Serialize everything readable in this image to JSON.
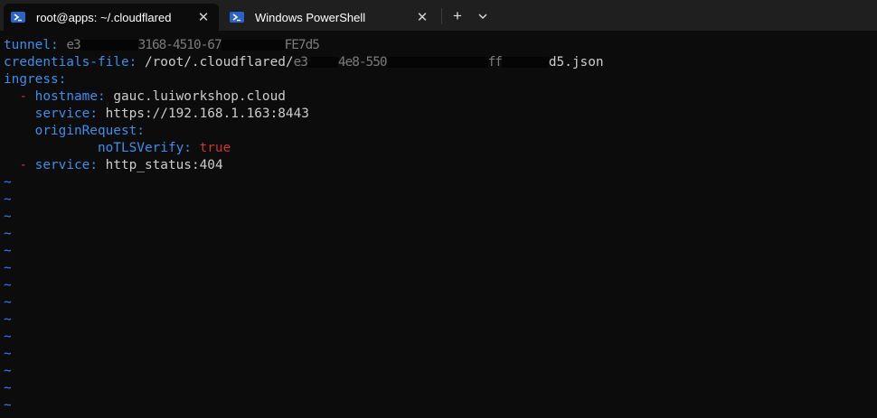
{
  "tabs": [
    {
      "title": "root@apps: ~/.cloudflared",
      "icon": "powershell-icon",
      "active": true
    },
    {
      "title": "Windows PowerShell",
      "icon": "powershell-icon",
      "active": false
    }
  ],
  "tabbar": {
    "new_tab": "+",
    "dropdown": "⌄",
    "close": "✕"
  },
  "editor": {
    "tunnel_key": "tunnel",
    "tunnel_fragments": [
      "e3",
      "3168-4510-67",
      "FE7d5"
    ],
    "credentials_key": "credentials-file",
    "credentials_prefix": "/root/.cloudflared/",
    "credentials_fragments": [
      "e3",
      "4e8-550",
      "ff",
      "d5.json"
    ],
    "ingress_key": "ingress",
    "dash": "-",
    "hostname_key": "hostname",
    "hostname_value": "gauc.luiworkshop.cloud",
    "service_key": "service",
    "service_value": "https://192.168.1.163:8443",
    "origin_key": "originRequest",
    "notls_key": "noTLSVerify",
    "notls_value": "true",
    "service2_value": "http_status:404",
    "tilde": "~"
  },
  "colors": {
    "background": "#0c0c0c",
    "key": "#3b8eea",
    "value": "#cccccc",
    "bool": "#cd3131",
    "tilde": "#3b78ff"
  }
}
